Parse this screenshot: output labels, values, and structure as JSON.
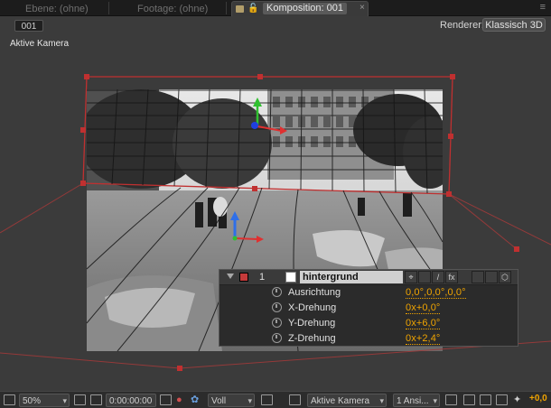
{
  "tabs": [
    {
      "label": "Ebene: (ohne)"
    },
    {
      "label": "Footage: (ohne)"
    }
  ],
  "active_tab": {
    "label": "Komposition: 001",
    "close": "×"
  },
  "viewer": {
    "comp_name": "001",
    "renderer_label": "Renderer:",
    "renderer_value": "Klassisch 3D",
    "camera_view": "Aktive Kamera"
  },
  "layer": {
    "number": "1",
    "name": "hintergrund",
    "label_color": "#c43a3a",
    "fx_label": "fx",
    "properties": [
      {
        "name": "Ausrichtung",
        "value": "0,0°,0,0°,0,0°"
      },
      {
        "name": "X-Drehung",
        "value": "0x+0,0°"
      },
      {
        "name": "Y-Drehung",
        "value": "0x+6,0°"
      },
      {
        "name": "Z-Drehung",
        "value": "0x+2,4°"
      }
    ]
  },
  "bottombar": {
    "zoom": "50%",
    "timecode": "0:00:00:00",
    "resolution": "Voll",
    "view": "Aktive Kamera",
    "views_count": "1 Ansi...",
    "exposure": "+0,0"
  },
  "colors": {
    "accent": "#f0a400",
    "bounding_box": "#c03030",
    "panel_bg": "#3b3b3b"
  }
}
